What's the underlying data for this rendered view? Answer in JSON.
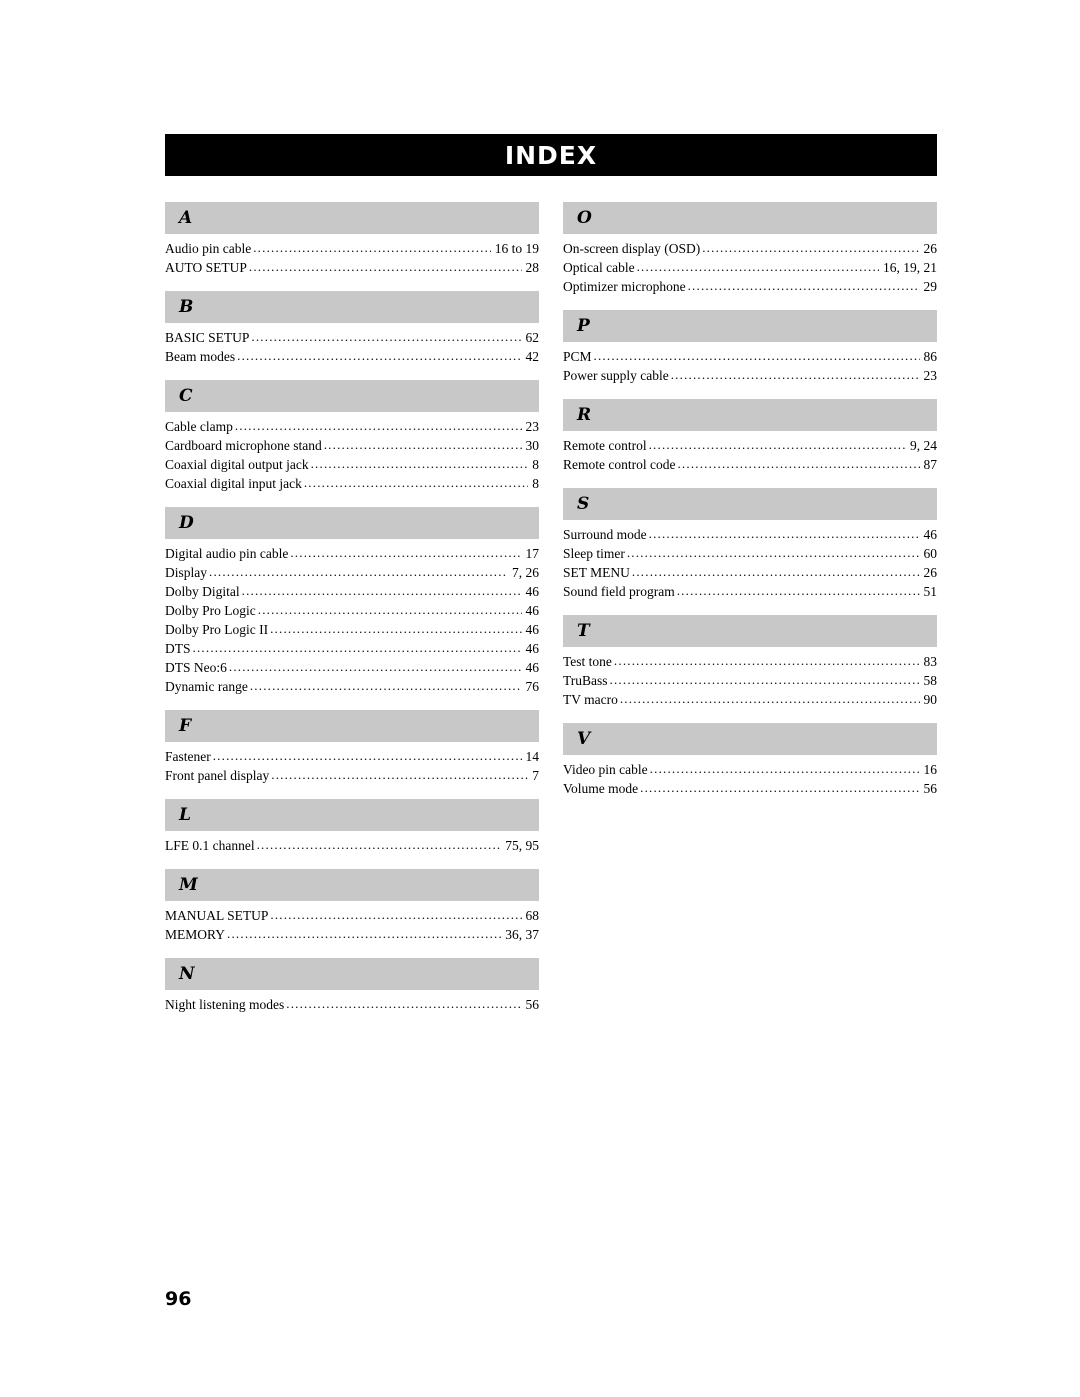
{
  "header": {
    "title": "INDEX"
  },
  "folio": "96",
  "colors": {
    "banner_bg": "#000000",
    "banner_text": "#ffffff",
    "letter_bg": "#c8c8c8"
  },
  "columns": [
    {
      "groups": [
        {
          "letter": "A",
          "entries": [
            {
              "label": "Audio pin cable",
              "page": "16 to 19"
            },
            {
              "label": "AUTO SETUP",
              "page": "28"
            }
          ]
        },
        {
          "letter": "B",
          "entries": [
            {
              "label": "BASIC SETUP",
              "page": "62"
            },
            {
              "label": "Beam modes",
              "page": "42"
            }
          ]
        },
        {
          "letter": "C",
          "entries": [
            {
              "label": "Cable clamp",
              "page": "23"
            },
            {
              "label": "Cardboard microphone stand",
              "page": "30"
            },
            {
              "label": "Coaxial digital output jack",
              "page": "8"
            },
            {
              "label": "Coaxial digital input jack",
              "page": "8"
            }
          ]
        },
        {
          "letter": "D",
          "entries": [
            {
              "label": "Digital audio pin cable",
              "page": "17"
            },
            {
              "label": "Display",
              "page": "7, 26"
            },
            {
              "label": "Dolby Digital",
              "page": "46"
            },
            {
              "label": "Dolby Pro Logic",
              "page": "46"
            },
            {
              "label": "Dolby Pro Logic II",
              "page": "46"
            },
            {
              "label": "DTS",
              "page": "46"
            },
            {
              "label": "DTS Neo:6",
              "page": "46"
            },
            {
              "label": "Dynamic range",
              "page": "76"
            }
          ]
        },
        {
          "letter": "F",
          "entries": [
            {
              "label": "Fastener",
              "page": "14"
            },
            {
              "label": "Front panel display",
              "page": "7"
            }
          ]
        },
        {
          "letter": "L",
          "entries": [
            {
              "label": "LFE 0.1 channel",
              "page": "75, 95"
            }
          ]
        },
        {
          "letter": "M",
          "entries": [
            {
              "label": "MANUAL SETUP",
              "page": "68"
            },
            {
              "label": "MEMORY",
              "page": "36, 37"
            }
          ]
        },
        {
          "letter": "N",
          "entries": [
            {
              "label": "Night listening modes",
              "page": "56"
            }
          ]
        }
      ]
    },
    {
      "groups": [
        {
          "letter": "O",
          "entries": [
            {
              "label": "On-screen display (OSD)",
              "page": "26"
            },
            {
              "label": "Optical cable",
              "page": "16, 19, 21"
            },
            {
              "label": "Optimizer microphone",
              "page": "29"
            }
          ]
        },
        {
          "letter": "P",
          "entries": [
            {
              "label": "PCM",
              "page": "86"
            },
            {
              "label": "Power supply cable",
              "page": "23"
            }
          ]
        },
        {
          "letter": "R",
          "entries": [
            {
              "label": "Remote control",
              "page": "9, 24"
            },
            {
              "label": "Remote control code",
              "page": "87"
            }
          ]
        },
        {
          "letter": "S",
          "entries": [
            {
              "label": "Surround mode",
              "page": "46"
            },
            {
              "label": "Sleep timer",
              "page": "60"
            },
            {
              "label": "SET MENU",
              "page": "26"
            },
            {
              "label": "Sound field program",
              "page": "51"
            }
          ]
        },
        {
          "letter": "T",
          "entries": [
            {
              "label": "Test tone",
              "page": "83"
            },
            {
              "label": "TruBass",
              "page": "58"
            },
            {
              "label": "TV macro",
              "page": "90"
            }
          ]
        },
        {
          "letter": "V",
          "entries": [
            {
              "label": "Video pin cable",
              "page": "16"
            },
            {
              "label": "Volume mode",
              "page": "56"
            }
          ]
        }
      ]
    }
  ]
}
